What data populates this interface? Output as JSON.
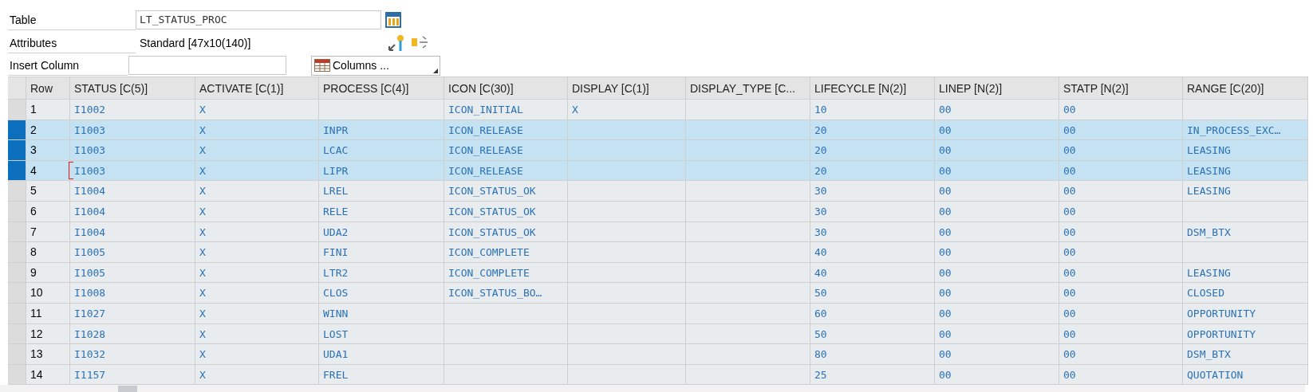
{
  "form": {
    "table": {
      "label": "Table",
      "value": "LT_STATUS_PROC"
    },
    "attributes": {
      "label": "Attributes",
      "value": "Standard [47x10(140)]"
    },
    "insert_column": {
      "label": "Insert Column"
    },
    "columns_button": "Columns ..."
  },
  "table": {
    "columns": [
      "Row",
      "STATUS [C(5)]",
      "ACTIVATE [C(1)]",
      "PROCESS [C(4)]",
      "ICON [C(30)]",
      "DISPLAY [C(1)]",
      "DISPLAY_TYPE [C...",
      "LIFECYCLE [N(2)]",
      "LINEP [N(2)]",
      "STATP [N(2)]",
      "RANGE [C(20)]"
    ],
    "rows": [
      {
        "selected": false,
        "focused": false,
        "cells": [
          "1",
          "I1002",
          "X",
          "",
          "ICON_INITIAL",
          "X",
          "",
          "10",
          "00",
          "00",
          ""
        ]
      },
      {
        "selected": true,
        "focused": false,
        "cells": [
          "2",
          "I1003",
          "X",
          "INPR",
          "ICON_RELEASE",
          "",
          "",
          "20",
          "00",
          "00",
          "IN_PROCESS_EXC…"
        ]
      },
      {
        "selected": true,
        "focused": false,
        "cells": [
          "3",
          "I1003",
          "X",
          "LCAC",
          "ICON_RELEASE",
          "",
          "",
          "20",
          "00",
          "00",
          "LEASING"
        ]
      },
      {
        "selected": true,
        "focused": true,
        "cells": [
          "4",
          "I1003",
          "X",
          "LIPR",
          "ICON_RELEASE",
          "",
          "",
          "20",
          "00",
          "00",
          "LEASING"
        ]
      },
      {
        "selected": false,
        "focused": false,
        "cells": [
          "5",
          "I1004",
          "X",
          "LREL",
          "ICON_STATUS_OK",
          "",
          "",
          "30",
          "00",
          "00",
          "LEASING"
        ]
      },
      {
        "selected": false,
        "focused": false,
        "cells": [
          "6",
          "I1004",
          "X",
          "RELE",
          "ICON_STATUS_OK",
          "",
          "",
          "30",
          "00",
          "00",
          ""
        ]
      },
      {
        "selected": false,
        "focused": false,
        "cells": [
          "7",
          "I1004",
          "X",
          "UDA2",
          "ICON_STATUS_OK",
          "",
          "",
          "30",
          "00",
          "00",
          "DSM_BTX"
        ]
      },
      {
        "selected": false,
        "focused": false,
        "cells": [
          "8",
          "I1005",
          "X",
          "FINI",
          "ICON_COMPLETE",
          "",
          "",
          "40",
          "00",
          "00",
          ""
        ]
      },
      {
        "selected": false,
        "focused": false,
        "cells": [
          "9",
          "I1005",
          "X",
          "LTR2",
          "ICON_COMPLETE",
          "",
          "",
          "40",
          "00",
          "00",
          "LEASING"
        ]
      },
      {
        "selected": false,
        "focused": false,
        "cells": [
          "10",
          "I1008",
          "X",
          "CLOS",
          "ICON_STATUS_BO…",
          "",
          "",
          "50",
          "00",
          "00",
          "CLOSED"
        ]
      },
      {
        "selected": false,
        "focused": false,
        "cells": [
          "11",
          "I1027",
          "X",
          "WINN",
          "",
          "",
          "",
          "60",
          "00",
          "00",
          "OPPORTUNITY"
        ]
      },
      {
        "selected": false,
        "focused": false,
        "cells": [
          "12",
          "I1028",
          "X",
          "LOST",
          "",
          "",
          "",
          "50",
          "00",
          "00",
          "OPPORTUNITY"
        ]
      },
      {
        "selected": false,
        "focused": false,
        "cells": [
          "13",
          "I1032",
          "X",
          "UDA1",
          "",
          "",
          "",
          "80",
          "00",
          "00",
          "DSM_BTX"
        ]
      },
      {
        "selected": false,
        "focused": false,
        "cells": [
          "14",
          "I1157",
          "X",
          "FREL",
          "",
          "",
          "",
          "25",
          "00",
          "00",
          "QUOTATION"
        ]
      }
    ]
  }
}
